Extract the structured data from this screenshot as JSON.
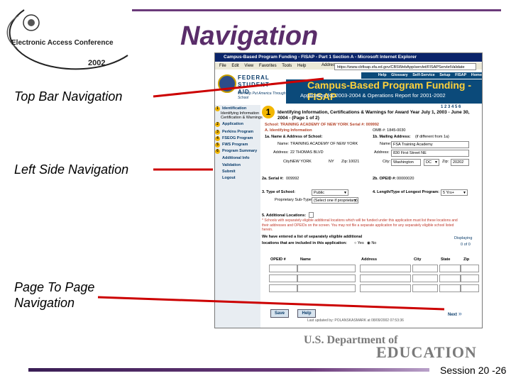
{
  "slide": {
    "title": "Navigation",
    "session_label": "Session 20 -26",
    "callouts": {
      "top_bar": "Top Bar Navigation",
      "left_side": "Left Side Navigation",
      "page_to_page_1": "Page To Page",
      "page_to_page_2": "Navigation"
    },
    "accent_color": "#5a2d6a",
    "line_color": "#cc0000"
  },
  "conference_logo": {
    "name": "Electronic Access Conference",
    "year": "2002"
  },
  "browser": {
    "window_title": "Campus-Based Program Funding - FISAP - Part 1 Section A - Microsoft Internet Explorer",
    "menu": [
      "File",
      "Edit",
      "View",
      "Favorites",
      "Tools",
      "Help"
    ],
    "address_label": "Address",
    "address_url": "https://www.cbfisap.sfa.ed.gov/CBSWebApp/servlet/FISAPServletValidate"
  },
  "site": {
    "top_nav": [
      "Help",
      "Glossary",
      "Self-Service",
      "Setup",
      "FISAP",
      "Home"
    ],
    "logo_text": "FEDERAL STUDENT AID",
    "logo_tagline": "We Help Put America Through School",
    "banner_title": "Campus-Based Program Funding - FISAP",
    "banner_subtitle": "Application for 2003-2004 & Operations Report for 2001-2002",
    "step_indicator": "1 2 3 4 5 6"
  },
  "left_nav": [
    {
      "num": "1",
      "label": "Identification"
    },
    {
      "num": "",
      "label": "Identifying Information"
    },
    {
      "num": "",
      "label": "Certification & Warnings"
    },
    {
      "num": "2",
      "label": "Application"
    },
    {
      "num": "3",
      "label": "Perkins Program"
    },
    {
      "num": "4",
      "label": "FSEOG Program"
    },
    {
      "num": "5",
      "label": "FWS Program"
    },
    {
      "num": "6",
      "label": "Program Summary"
    },
    {
      "num": "",
      "label": "Additional Info"
    },
    {
      "num": "",
      "label": "Validation"
    },
    {
      "num": "",
      "label": "Submit"
    },
    {
      "num": "",
      "label": "Logout"
    }
  ],
  "form": {
    "step_number": "1",
    "section_title": "Identifying Information, Certifications & Warnings for Award Year July 1, 2003 - June 30, 2004 - (Page 1 of 2)",
    "school_line": "School: TRAINING ACADEMY OF NEW YORK   Serial #: 009992",
    "part_a": "A. Identifying Information",
    "ombid": "OMB #: 1845-0030",
    "q1a": "1a. Name & Address of School:",
    "q1b": "1b. Mailing Address:",
    "q1b_note": "(if different from 1a)",
    "name_label": "Name:",
    "school_name": "TRAINING ACADEMY OF NEW YORK",
    "address_label": "Address:",
    "school_address": "22 THOMAS BLVD",
    "city_label": "City:",
    "school_city": "NEW YORK",
    "school_state": "NY",
    "zip_label": "Zip:",
    "school_zip": "10021",
    "mail_name": "FSA Training Academy",
    "mail_address": "830 First Street NE",
    "mail_city": "Washington",
    "mail_state": "DC",
    "mail_zip": "20202",
    "q2a": "2a. Serial #:",
    "q2a_value": "009992",
    "q2b": "2b. OPEID #:",
    "q2b_value": "00000020",
    "q3": "3. Type of School:",
    "q3_value": "Public",
    "q3_sub": "Proprietary Sub-Type:",
    "q3_sub_value": "(Select one if proprietary)",
    "q4": "4. Length/Type of Longest Program:",
    "q4_value": "5 Yrs+",
    "q5": "5. Additional Locations:",
    "q5_notes": [
      "* Schools with separately eligible additional locations which will be funded under this application must list these locations and",
      "their addresses and OPEIDs on the screen. You may not file a separate application for any separately eligible school listed",
      "herein."
    ],
    "q5_question_1": "We have entered a list of separately eligible additional",
    "q5_question_2": "locations that are included in this application:",
    "yes_label": "Yes",
    "no_label": "No",
    "displaying": "Displaying",
    "displaying_count": "0 of 0",
    "table_headers": [
      "OPEID #",
      "Name",
      "Address",
      "City",
      "State",
      "Zip"
    ],
    "save_label": "Save",
    "help_label": "Help",
    "next_label": "Next",
    "last_updated": "Last updated by: POLANSKASMARK at 08/09/2002 07:53:36"
  },
  "doe_logo": {
    "top": "U.S. Department of",
    "bottom": "EDUCATION"
  }
}
